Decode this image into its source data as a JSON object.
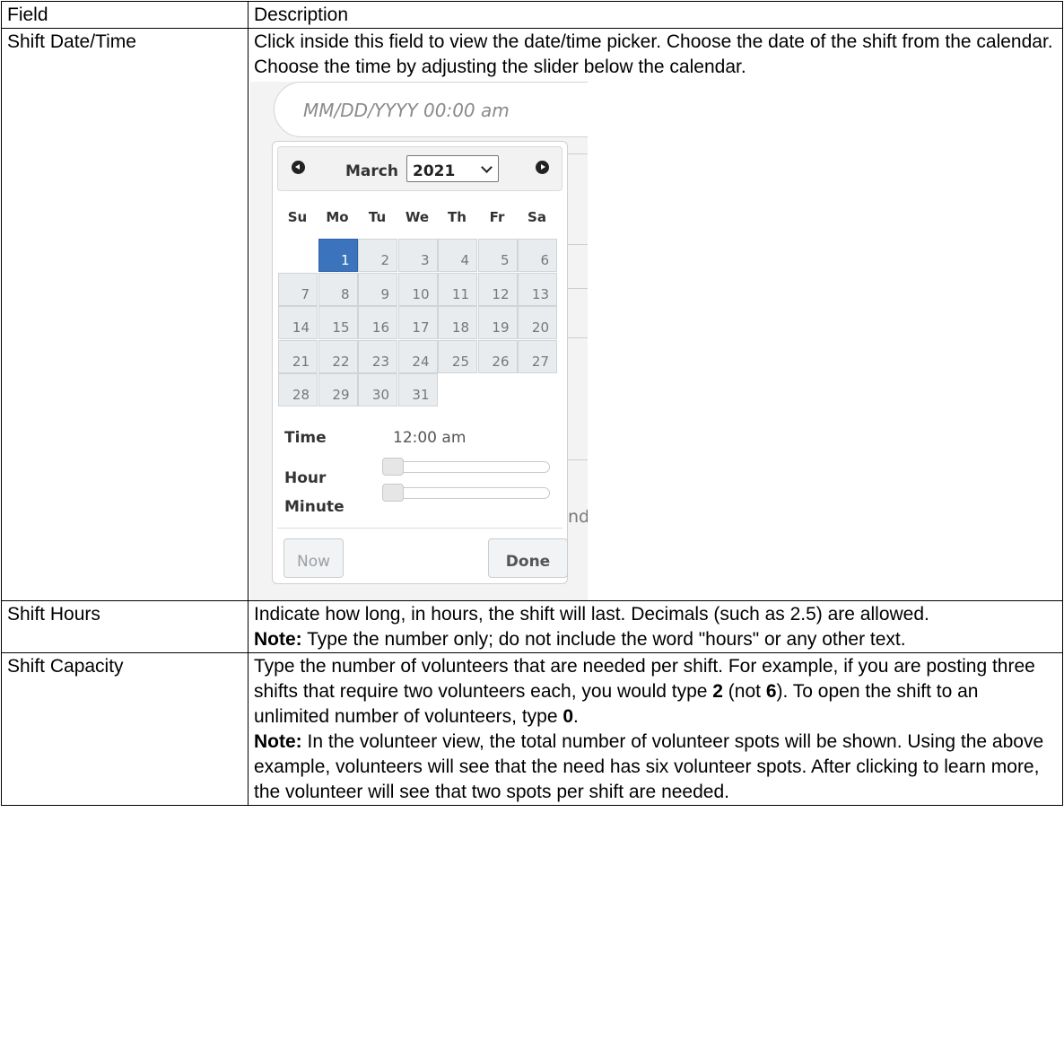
{
  "table": {
    "header": {
      "field": "Field",
      "description": "Description"
    },
    "rows": [
      {
        "field": "Shift Date/Time",
        "description": "Click inside this field to view the date/time picker. Choose the date of the shift from the calendar. Choose the time by adjusting the slider below the calendar."
      },
      {
        "field": "Shift Hours",
        "description": "Indicate how long, in hours, the shift will last. Decimals (such as 2.5) are allowed.",
        "note_label": "Note:",
        "note_text": " Type the number only; do not include the word \"hours\" or any other text."
      },
      {
        "field": "Shift Capacity",
        "desc_a": "Type the number of volunteers that are needed per shift. For example, if you are posting three shifts that require two volunteers each, you would type ",
        "desc_num1": "2",
        "desc_b": " (not ",
        "desc_num2": "6",
        "desc_c": "). To open the shift to an unlimited number of volunteers, type ",
        "desc_num3": "0",
        "desc_d": ".",
        "note_label": "Note:",
        "note_text": " In the volunteer view, the total number of volunteer spots will be shown. Using the above example, volunteers will see that the need has six volunteer spots. After clicking to learn more, the volunteer will see that two spots per shift are needed."
      }
    ]
  },
  "picker": {
    "input_placeholder": "MM/DD/YYYY 00:00 am",
    "month": "March",
    "year": "2021",
    "weekdays": [
      "Su",
      "Mo",
      "Tu",
      "We",
      "Th",
      "Fr",
      "Sa"
    ],
    "days": [
      "1",
      "2",
      "3",
      "4",
      "5",
      "6",
      "7",
      "8",
      "9",
      "10",
      "11",
      "12",
      "13",
      "14",
      "15",
      "16",
      "17",
      "18",
      "19",
      "20",
      "21",
      "22",
      "23",
      "24",
      "25",
      "26",
      "27",
      "28",
      "29",
      "30",
      "31"
    ],
    "first_weekday_index": 1,
    "selected_day": "1",
    "time_label": "Time",
    "time_value": "12:00 am",
    "hour_label": "Hour",
    "minute_label": "Minute",
    "hour_level": 0,
    "minute_level": 0,
    "now_label": "Now",
    "done_label": "Done",
    "background_fragment": "nd",
    "colors": {
      "selected_day": "#3b74bc",
      "day_cell": "#e9ecee"
    }
  }
}
